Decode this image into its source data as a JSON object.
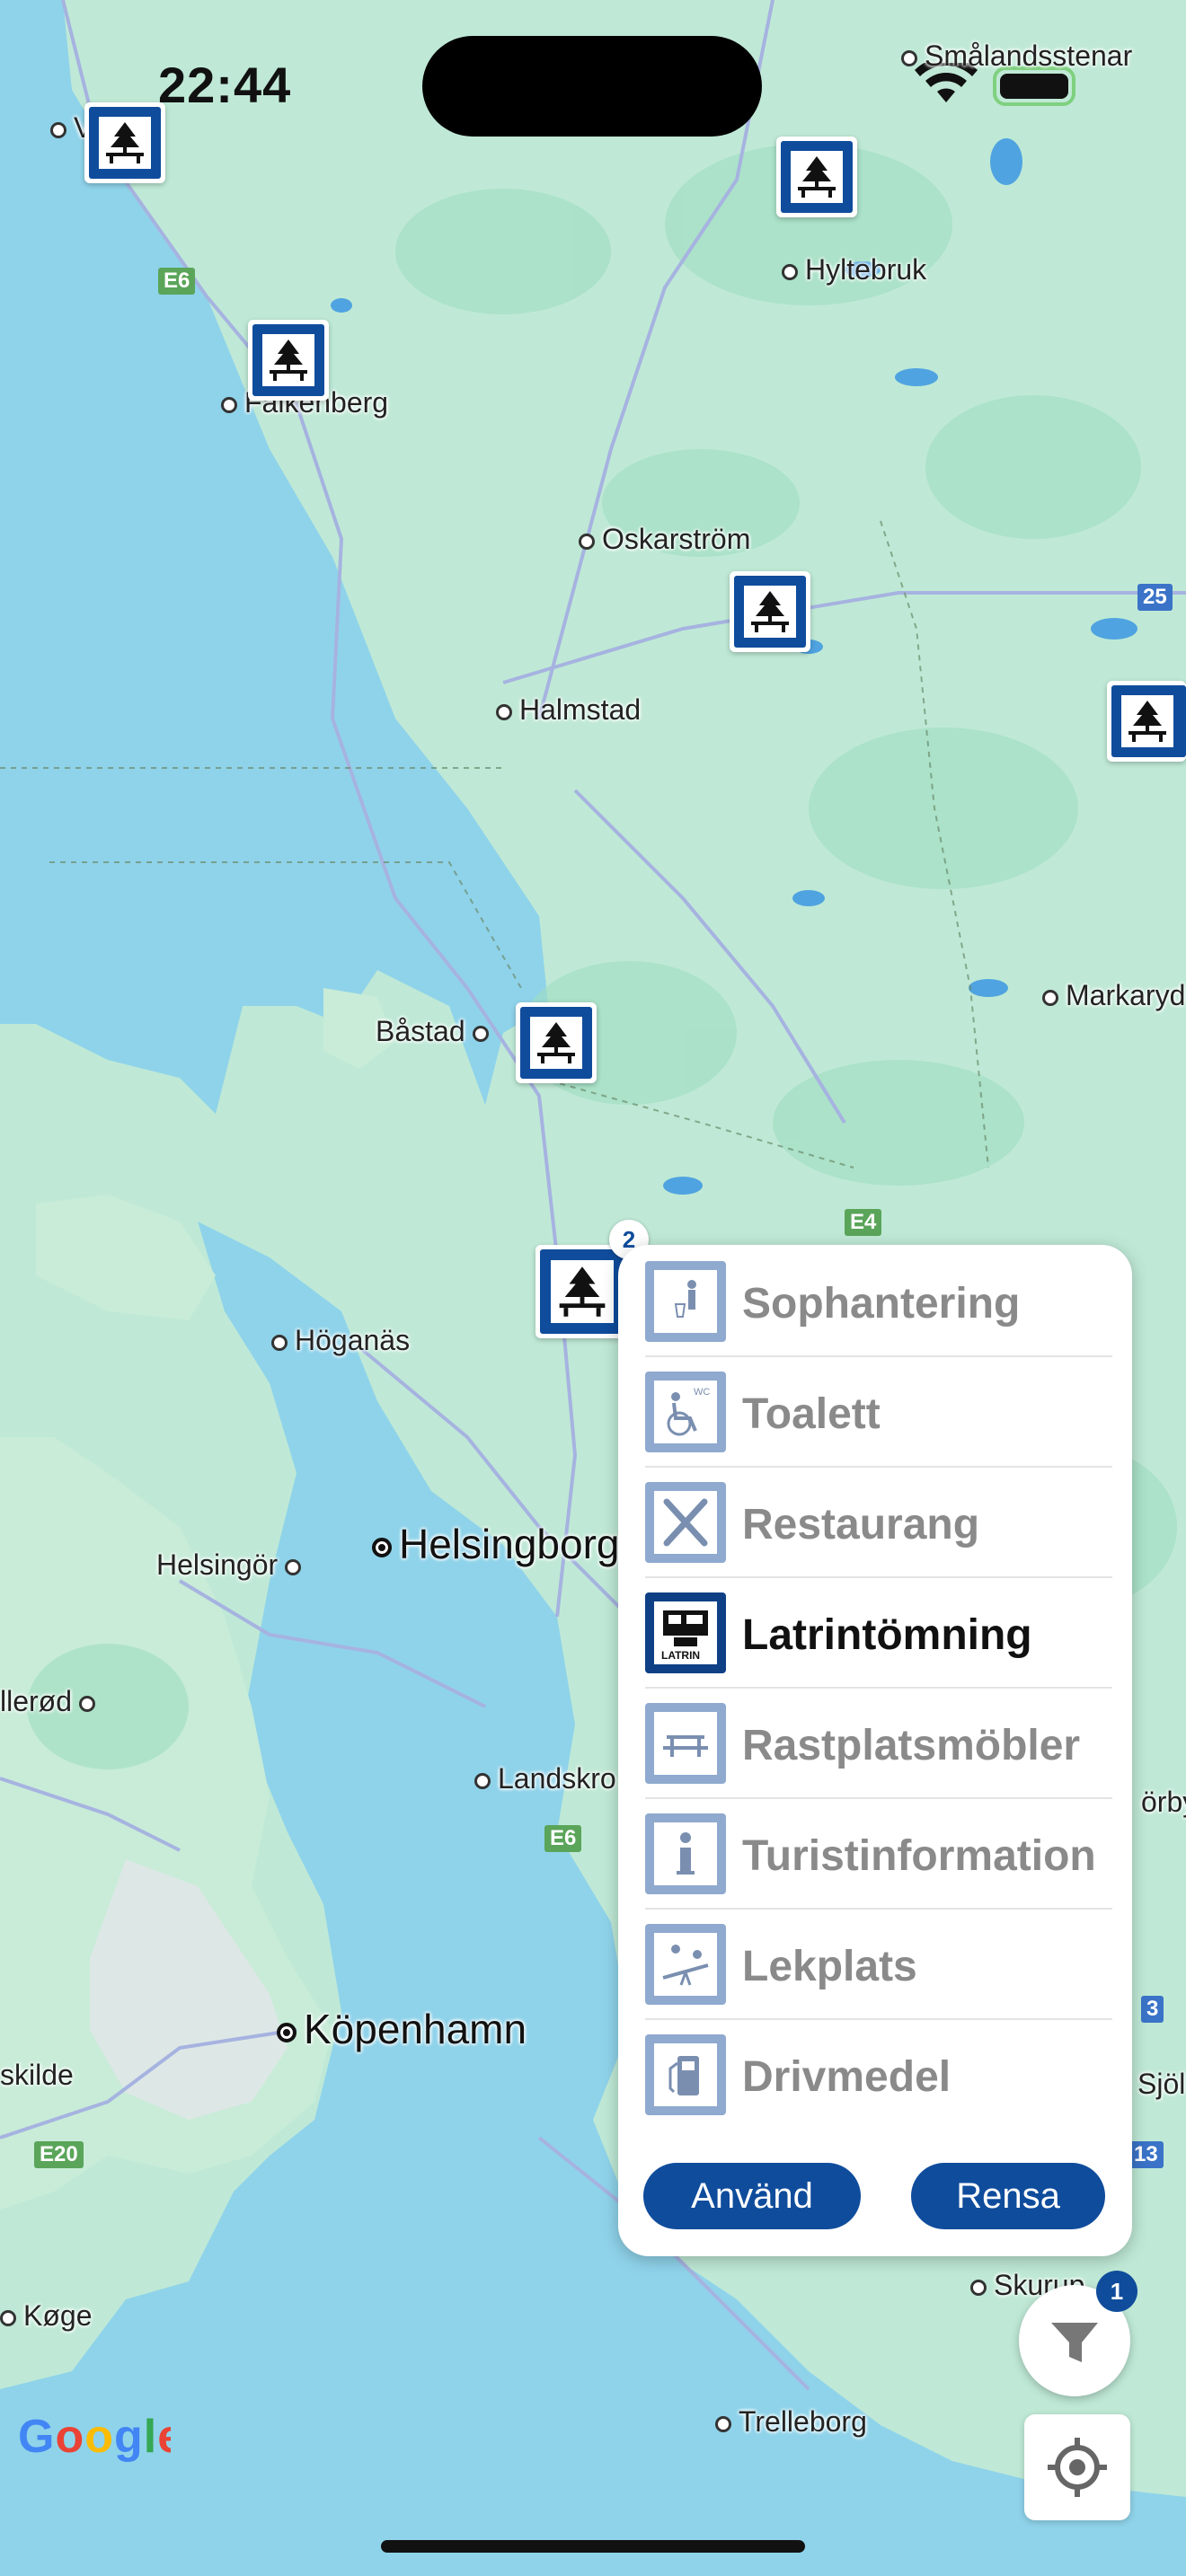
{
  "status_bar": {
    "time": "22:44"
  },
  "map": {
    "places": [
      {
        "id": "smalandsstenar",
        "name": "Smålandsstenar"
      },
      {
        "id": "hyltebruk",
        "name": "Hyltebruk"
      },
      {
        "id": "falkenberg",
        "name": "Falkenberg"
      },
      {
        "id": "oskarstrom",
        "name": "Oskarström"
      },
      {
        "id": "halmstad",
        "name": "Halmstad"
      },
      {
        "id": "markaryd",
        "name": "Markaryd"
      },
      {
        "id": "bastad",
        "name": "Båstad"
      },
      {
        "id": "hoganas",
        "name": "Höganäs"
      },
      {
        "id": "helsingor",
        "name": "Helsingör"
      },
      {
        "id": "helsingborg",
        "name": "Helsingborg"
      },
      {
        "id": "allerod",
        "name": "llerød"
      },
      {
        "id": "landskrona",
        "name": "Landskro"
      },
      {
        "id": "kobenhavn",
        "name": "Köpenhamn"
      },
      {
        "id": "roskilde",
        "name": "skilde"
      },
      {
        "id": "koge",
        "name": "Køge"
      },
      {
        "id": "trelleborg",
        "name": "Trelleborg"
      },
      {
        "id": "skurup",
        "name": "Skurup"
      },
      {
        "id": "sjobo",
        "name": "Sjöl"
      },
      {
        "id": "horby",
        "name": "örby"
      },
      {
        "id": "varberg",
        "name": "V"
      }
    ],
    "road_shields": [
      {
        "id": "e6-north",
        "label": "E6",
        "type": "green"
      },
      {
        "id": "25",
        "label": "25",
        "type": "blue"
      },
      {
        "id": "e4",
        "label": "E4",
        "type": "green"
      },
      {
        "id": "e6-south",
        "label": "E6",
        "type": "green"
      },
      {
        "id": "e20",
        "label": "E20",
        "type": "green"
      },
      {
        "id": "13",
        "label": "13",
        "type": "blue"
      },
      {
        "id": "3",
        "label": "3",
        "type": "blue"
      }
    ],
    "cluster_count": "2",
    "attribution": "Google"
  },
  "filter_panel": {
    "items": [
      {
        "label": "Sophantering",
        "active": false,
        "icon": "trash-person-icon"
      },
      {
        "label": "Toalett",
        "active": false,
        "icon": "wheelchair-wc-icon"
      },
      {
        "label": "Restaurang",
        "active": false,
        "icon": "fork-knife-icon"
      },
      {
        "label": "Latrintömning",
        "active": true,
        "icon": "latrine-dump-icon"
      },
      {
        "label": "Rastplatsmöbler",
        "active": false,
        "icon": "picnic-table-icon"
      },
      {
        "label": "Turistinformation",
        "active": false,
        "icon": "info-icon"
      },
      {
        "label": "Lekplats",
        "active": false,
        "icon": "playground-icon"
      },
      {
        "label": "Drivmedel",
        "active": false,
        "icon": "fuel-pump-icon"
      }
    ],
    "apply_label": "Använd",
    "clear_label": "Rensa"
  },
  "filter_button": {
    "badge": "1"
  },
  "colors": {
    "brand_blue": "#0f4c9c",
    "inactive_icon": "#8fa9cf",
    "water": "#8fd3ea",
    "land": "#bfe9d6"
  }
}
